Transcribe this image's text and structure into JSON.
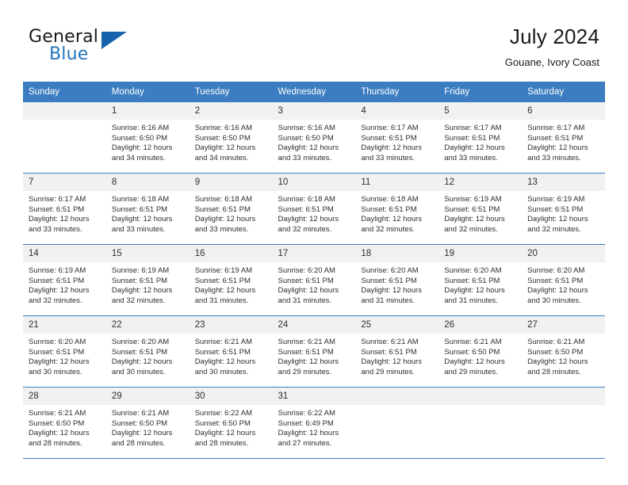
{
  "brand": {
    "word_one": "General",
    "word_two": "Blue",
    "accent_color": "#2375bb",
    "triangle_color": "#1763ab"
  },
  "header": {
    "title": "July 2024",
    "location": "Gouane, Ivory Coast"
  },
  "calendar": {
    "header_bg": "#3b7dc0",
    "daynum_bg": "#f1f1f1",
    "weekday_headers": [
      "Sunday",
      "Monday",
      "Tuesday",
      "Wednesday",
      "Thursday",
      "Friday",
      "Saturday"
    ],
    "weeks": [
      [
        {
          "day": "",
          "empty": true
        },
        {
          "day": "1",
          "sunrise": "Sunrise: 6:16 AM",
          "sunset": "Sunset: 6:50 PM",
          "daylight_1": "Daylight: 12 hours",
          "daylight_2": "and 34 minutes."
        },
        {
          "day": "2",
          "sunrise": "Sunrise: 6:16 AM",
          "sunset": "Sunset: 6:50 PM",
          "daylight_1": "Daylight: 12 hours",
          "daylight_2": "and 34 minutes."
        },
        {
          "day": "3",
          "sunrise": "Sunrise: 6:16 AM",
          "sunset": "Sunset: 6:50 PM",
          "daylight_1": "Daylight: 12 hours",
          "daylight_2": "and 33 minutes."
        },
        {
          "day": "4",
          "sunrise": "Sunrise: 6:17 AM",
          "sunset": "Sunset: 6:51 PM",
          "daylight_1": "Daylight: 12 hours",
          "daylight_2": "and 33 minutes."
        },
        {
          "day": "5",
          "sunrise": "Sunrise: 6:17 AM",
          "sunset": "Sunset: 6:51 PM",
          "daylight_1": "Daylight: 12 hours",
          "daylight_2": "and 33 minutes."
        },
        {
          "day": "6",
          "sunrise": "Sunrise: 6:17 AM",
          "sunset": "Sunset: 6:51 PM",
          "daylight_1": "Daylight: 12 hours",
          "daylight_2": "and 33 minutes."
        }
      ],
      [
        {
          "day": "7",
          "sunrise": "Sunrise: 6:17 AM",
          "sunset": "Sunset: 6:51 PM",
          "daylight_1": "Daylight: 12 hours",
          "daylight_2": "and 33 minutes."
        },
        {
          "day": "8",
          "sunrise": "Sunrise: 6:18 AM",
          "sunset": "Sunset: 6:51 PM",
          "daylight_1": "Daylight: 12 hours",
          "daylight_2": "and 33 minutes."
        },
        {
          "day": "9",
          "sunrise": "Sunrise: 6:18 AM",
          "sunset": "Sunset: 6:51 PM",
          "daylight_1": "Daylight: 12 hours",
          "daylight_2": "and 33 minutes."
        },
        {
          "day": "10",
          "sunrise": "Sunrise: 6:18 AM",
          "sunset": "Sunset: 6:51 PM",
          "daylight_1": "Daylight: 12 hours",
          "daylight_2": "and 32 minutes."
        },
        {
          "day": "11",
          "sunrise": "Sunrise: 6:18 AM",
          "sunset": "Sunset: 6:51 PM",
          "daylight_1": "Daylight: 12 hours",
          "daylight_2": "and 32 minutes."
        },
        {
          "day": "12",
          "sunrise": "Sunrise: 6:19 AM",
          "sunset": "Sunset: 6:51 PM",
          "daylight_1": "Daylight: 12 hours",
          "daylight_2": "and 32 minutes."
        },
        {
          "day": "13",
          "sunrise": "Sunrise: 6:19 AM",
          "sunset": "Sunset: 6:51 PM",
          "daylight_1": "Daylight: 12 hours",
          "daylight_2": "and 32 minutes."
        }
      ],
      [
        {
          "day": "14",
          "sunrise": "Sunrise: 6:19 AM",
          "sunset": "Sunset: 6:51 PM",
          "daylight_1": "Daylight: 12 hours",
          "daylight_2": "and 32 minutes."
        },
        {
          "day": "15",
          "sunrise": "Sunrise: 6:19 AM",
          "sunset": "Sunset: 6:51 PM",
          "daylight_1": "Daylight: 12 hours",
          "daylight_2": "and 32 minutes."
        },
        {
          "day": "16",
          "sunrise": "Sunrise: 6:19 AM",
          "sunset": "Sunset: 6:51 PM",
          "daylight_1": "Daylight: 12 hours",
          "daylight_2": "and 31 minutes."
        },
        {
          "day": "17",
          "sunrise": "Sunrise: 6:20 AM",
          "sunset": "Sunset: 6:51 PM",
          "daylight_1": "Daylight: 12 hours",
          "daylight_2": "and 31 minutes."
        },
        {
          "day": "18",
          "sunrise": "Sunrise: 6:20 AM",
          "sunset": "Sunset: 6:51 PM",
          "daylight_1": "Daylight: 12 hours",
          "daylight_2": "and 31 minutes."
        },
        {
          "day": "19",
          "sunrise": "Sunrise: 6:20 AM",
          "sunset": "Sunset: 6:51 PM",
          "daylight_1": "Daylight: 12 hours",
          "daylight_2": "and 31 minutes."
        },
        {
          "day": "20",
          "sunrise": "Sunrise: 6:20 AM",
          "sunset": "Sunset: 6:51 PM",
          "daylight_1": "Daylight: 12 hours",
          "daylight_2": "and 30 minutes."
        }
      ],
      [
        {
          "day": "21",
          "sunrise": "Sunrise: 6:20 AM",
          "sunset": "Sunset: 6:51 PM",
          "daylight_1": "Daylight: 12 hours",
          "daylight_2": "and 30 minutes."
        },
        {
          "day": "22",
          "sunrise": "Sunrise: 6:20 AM",
          "sunset": "Sunset: 6:51 PM",
          "daylight_1": "Daylight: 12 hours",
          "daylight_2": "and 30 minutes."
        },
        {
          "day": "23",
          "sunrise": "Sunrise: 6:21 AM",
          "sunset": "Sunset: 6:51 PM",
          "daylight_1": "Daylight: 12 hours",
          "daylight_2": "and 30 minutes."
        },
        {
          "day": "24",
          "sunrise": "Sunrise: 6:21 AM",
          "sunset": "Sunset: 6:51 PM",
          "daylight_1": "Daylight: 12 hours",
          "daylight_2": "and 29 minutes."
        },
        {
          "day": "25",
          "sunrise": "Sunrise: 6:21 AM",
          "sunset": "Sunset: 6:51 PM",
          "daylight_1": "Daylight: 12 hours",
          "daylight_2": "and 29 minutes."
        },
        {
          "day": "26",
          "sunrise": "Sunrise: 6:21 AM",
          "sunset": "Sunset: 6:50 PM",
          "daylight_1": "Daylight: 12 hours",
          "daylight_2": "and 29 minutes."
        },
        {
          "day": "27",
          "sunrise": "Sunrise: 6:21 AM",
          "sunset": "Sunset: 6:50 PM",
          "daylight_1": "Daylight: 12 hours",
          "daylight_2": "and 28 minutes."
        }
      ],
      [
        {
          "day": "28",
          "sunrise": "Sunrise: 6:21 AM",
          "sunset": "Sunset: 6:50 PM",
          "daylight_1": "Daylight: 12 hours",
          "daylight_2": "and 28 minutes."
        },
        {
          "day": "29",
          "sunrise": "Sunrise: 6:21 AM",
          "sunset": "Sunset: 6:50 PM",
          "daylight_1": "Daylight: 12 hours",
          "daylight_2": "and 28 minutes."
        },
        {
          "day": "30",
          "sunrise": "Sunrise: 6:22 AM",
          "sunset": "Sunset: 6:50 PM",
          "daylight_1": "Daylight: 12 hours",
          "daylight_2": "and 28 minutes."
        },
        {
          "day": "31",
          "sunrise": "Sunrise: 6:22 AM",
          "sunset": "Sunset: 6:49 PM",
          "daylight_1": "Daylight: 12 hours",
          "daylight_2": "and 27 minutes."
        },
        {
          "day": "",
          "empty": true
        },
        {
          "day": "",
          "empty": true
        },
        {
          "day": "",
          "empty": true
        }
      ]
    ]
  }
}
